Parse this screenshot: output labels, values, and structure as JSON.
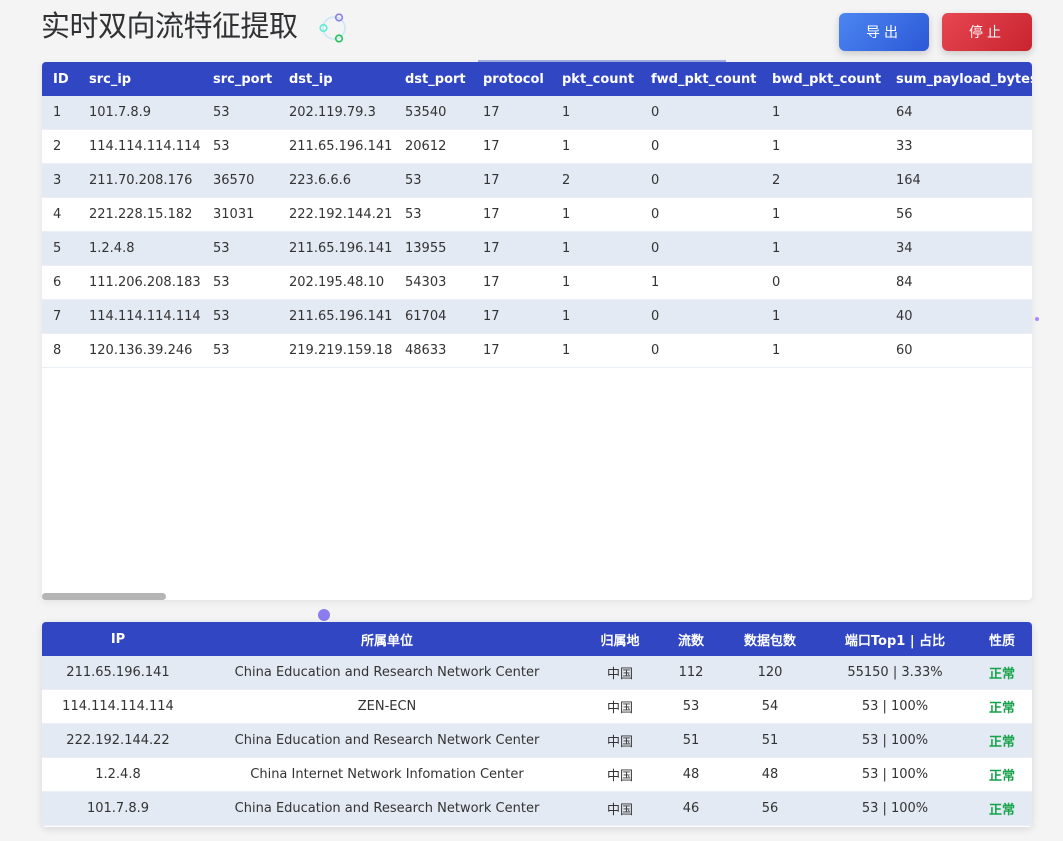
{
  "page": {
    "title": "实时双向流特征提取"
  },
  "buttons": {
    "export_label": "导出",
    "stop_label": "停止"
  },
  "colors": {
    "header": "#3046c3",
    "export": "#2c58d6",
    "stop": "#c7242f",
    "row_alt": "#e4eaf3",
    "status_normal": "#16a34a"
  },
  "flow_table": {
    "columns": [
      "ID",
      "src_ip",
      "src_port",
      "dst_ip",
      "dst_port",
      "protocol",
      "pkt_count",
      "fwd_pkt_count",
      "bwd_pkt_count",
      "sum_payload_bytes"
    ],
    "rows": [
      [
        "1",
        "101.7.8.9",
        "53",
        "202.119.79.3",
        "53540",
        "17",
        "1",
        "0",
        "1",
        "64"
      ],
      [
        "2",
        "114.114.114.114",
        "53",
        "211.65.196.141",
        "20612",
        "17",
        "1",
        "0",
        "1",
        "33"
      ],
      [
        "3",
        "211.70.208.176",
        "36570",
        "223.6.6.6",
        "53",
        "17",
        "2",
        "0",
        "2",
        "164"
      ],
      [
        "4",
        "221.228.15.182",
        "31031",
        "222.192.144.21",
        "53",
        "17",
        "1",
        "0",
        "1",
        "56"
      ],
      [
        "5",
        "1.2.4.8",
        "53",
        "211.65.196.141",
        "13955",
        "17",
        "1",
        "0",
        "1",
        "34"
      ],
      [
        "6",
        "111.206.208.183",
        "53",
        "202.195.48.10",
        "54303",
        "17",
        "1",
        "1",
        "0",
        "84"
      ],
      [
        "7",
        "114.114.114.114",
        "53",
        "211.65.196.141",
        "61704",
        "17",
        "1",
        "0",
        "1",
        "40"
      ],
      [
        "8",
        "120.136.39.246",
        "53",
        "219.219.159.18",
        "48633",
        "17",
        "1",
        "0",
        "1",
        "60"
      ]
    ]
  },
  "ip_table": {
    "columns": [
      "IP",
      "所属单位",
      "归属地",
      "流数",
      "数据包数",
      "端口Top1 | 占比",
      "性质"
    ],
    "rows": [
      [
        "211.65.196.141",
        "China Education and Research Network Center",
        "中国",
        "112",
        "120",
        "55150 | 3.33%",
        "正常"
      ],
      [
        "114.114.114.114",
        "ZEN-ECN",
        "中国",
        "53",
        "54",
        "53 | 100%",
        "正常"
      ],
      [
        "222.192.144.22",
        "China Education and Research Network Center",
        "中国",
        "51",
        "51",
        "53 | 100%",
        "正常"
      ],
      [
        "1.2.4.8",
        "China Internet Network Infomation Center",
        "中国",
        "48",
        "48",
        "53 | 100%",
        "正常"
      ],
      [
        "101.7.8.9",
        "China Education and Research Network Center",
        "中国",
        "46",
        "56",
        "53 | 100%",
        "正常"
      ]
    ]
  },
  "icons": {
    "loading": "loading-spinner-icon"
  }
}
